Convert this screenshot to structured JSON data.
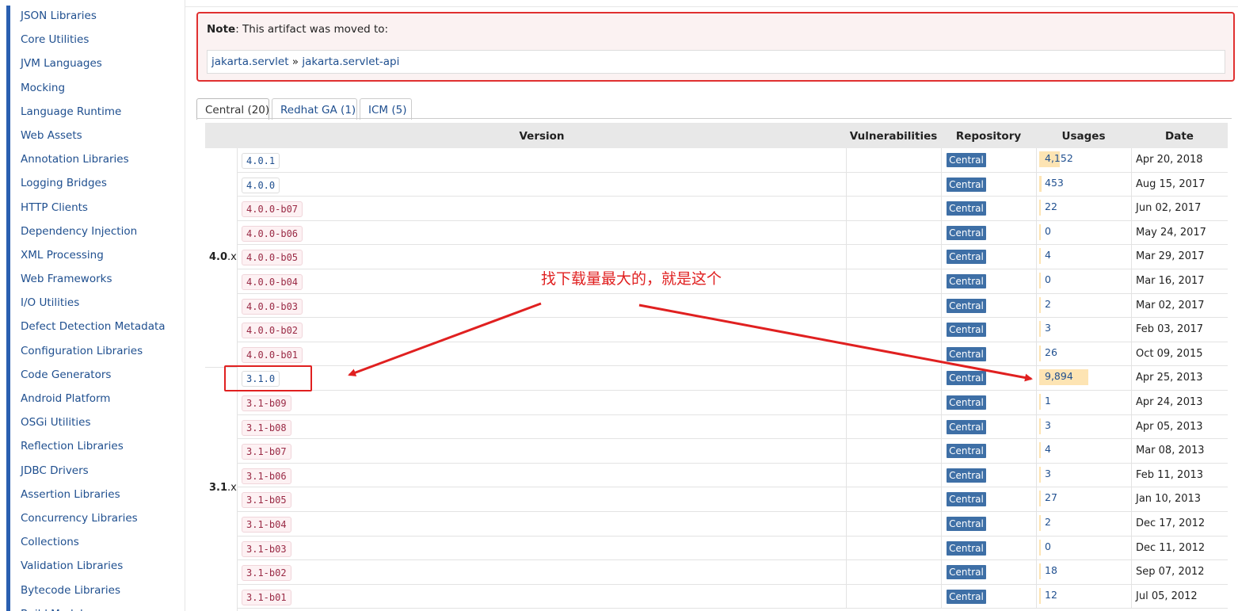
{
  "sidebar": {
    "items": [
      "JSON Libraries",
      "Core Utilities",
      "JVM Languages",
      "Mocking",
      "Language Runtime",
      "Web Assets",
      "Annotation Libraries",
      "Logging Bridges",
      "HTTP Clients",
      "Dependency Injection",
      "XML Processing",
      "Web Frameworks",
      "I/O Utilities",
      "Defect Detection Metadata",
      "Configuration Libraries",
      "Code Generators",
      "Android Platform",
      "OSGi Utilities",
      "Reflection Libraries",
      "JDBC Drivers",
      "Assertion Libraries",
      "Concurrency Libraries",
      "Collections",
      "Validation Libraries",
      "Bytecode Libraries",
      "Build Models"
    ]
  },
  "note": {
    "label": "Note",
    "text": ": This artifact was moved to:",
    "group_link": "jakarta.servlet",
    "sep": " » ",
    "artifact_link": "jakarta.servlet-api"
  },
  "tabs": [
    "Central (20)",
    "Redhat GA (1)",
    "ICM (5)"
  ],
  "table": {
    "headers": {
      "version": "Version",
      "vulnerabilities": "Vulnerabilities",
      "repository": "Repository",
      "usages": "Usages",
      "date": "Date"
    },
    "groups": [
      {
        "major": "4.0",
        "suffix": ".x"
      },
      {
        "major": "3.1",
        "suffix": ".x"
      }
    ],
    "max_usages": 9894,
    "rows": [
      {
        "version": "4.0.1",
        "beta": false,
        "repo": "Central",
        "usages": "4,152",
        "usage_value": 4152,
        "date": "Apr 20, 2018"
      },
      {
        "version": "4.0.0",
        "beta": false,
        "repo": "Central",
        "usages": "453",
        "usage_value": 453,
        "date": "Aug 15, 2017"
      },
      {
        "version": "4.0.0-b07",
        "beta": true,
        "repo": "Central",
        "usages": "22",
        "usage_value": 22,
        "date": "Jun 02, 2017"
      },
      {
        "version": "4.0.0-b06",
        "beta": true,
        "repo": "Central",
        "usages": "0",
        "usage_value": 0,
        "date": "May 24, 2017"
      },
      {
        "version": "4.0.0-b05",
        "beta": true,
        "repo": "Central",
        "usages": "4",
        "usage_value": 4,
        "date": "Mar 29, 2017"
      },
      {
        "version": "4.0.0-b04",
        "beta": true,
        "repo": "Central",
        "usages": "0",
        "usage_value": 0,
        "date": "Mar 16, 2017"
      },
      {
        "version": "4.0.0-b03",
        "beta": true,
        "repo": "Central",
        "usages": "2",
        "usage_value": 2,
        "date": "Mar 02, 2017"
      },
      {
        "version": "4.0.0-b02",
        "beta": true,
        "repo": "Central",
        "usages": "3",
        "usage_value": 3,
        "date": "Feb 03, 2017"
      },
      {
        "version": "4.0.0-b01",
        "beta": true,
        "repo": "Central",
        "usages": "26",
        "usage_value": 26,
        "date": "Oct 09, 2015"
      },
      {
        "version": "3.1.0",
        "beta": false,
        "repo": "Central",
        "usages": "9,894",
        "usage_value": 9894,
        "date": "Apr 25, 2013"
      },
      {
        "version": "3.1-b09",
        "beta": true,
        "repo": "Central",
        "usages": "1",
        "usage_value": 1,
        "date": "Apr 24, 2013"
      },
      {
        "version": "3.1-b08",
        "beta": true,
        "repo": "Central",
        "usages": "3",
        "usage_value": 3,
        "date": "Apr 05, 2013"
      },
      {
        "version": "3.1-b07",
        "beta": true,
        "repo": "Central",
        "usages": "4",
        "usage_value": 4,
        "date": "Mar 08, 2013"
      },
      {
        "version": "3.1-b06",
        "beta": true,
        "repo": "Central",
        "usages": "3",
        "usage_value": 3,
        "date": "Feb 11, 2013"
      },
      {
        "version": "3.1-b05",
        "beta": true,
        "repo": "Central",
        "usages": "27",
        "usage_value": 27,
        "date": "Jan 10, 2013"
      },
      {
        "version": "3.1-b04",
        "beta": true,
        "repo": "Central",
        "usages": "2",
        "usage_value": 2,
        "date": "Dec 17, 2012"
      },
      {
        "version": "3.1-b03",
        "beta": true,
        "repo": "Central",
        "usages": "0",
        "usage_value": 0,
        "date": "Dec 11, 2012"
      },
      {
        "version": "3.1-b02",
        "beta": true,
        "repo": "Central",
        "usages": "18",
        "usage_value": 18,
        "date": "Sep 07, 2012"
      },
      {
        "version": "3.1-b01",
        "beta": true,
        "repo": "Central",
        "usages": "12",
        "usage_value": 12,
        "date": "Jul 05, 2012"
      }
    ]
  },
  "annotation": {
    "text": "找下载量最大的，就是这个",
    "color": "#e02020"
  },
  "colors": {
    "accent": "#2a5fb0",
    "link": "#1f4f8f",
    "central_badge": "#3e6fa6",
    "usage_bar": "#fde4b3",
    "note_border": "#e03030"
  }
}
